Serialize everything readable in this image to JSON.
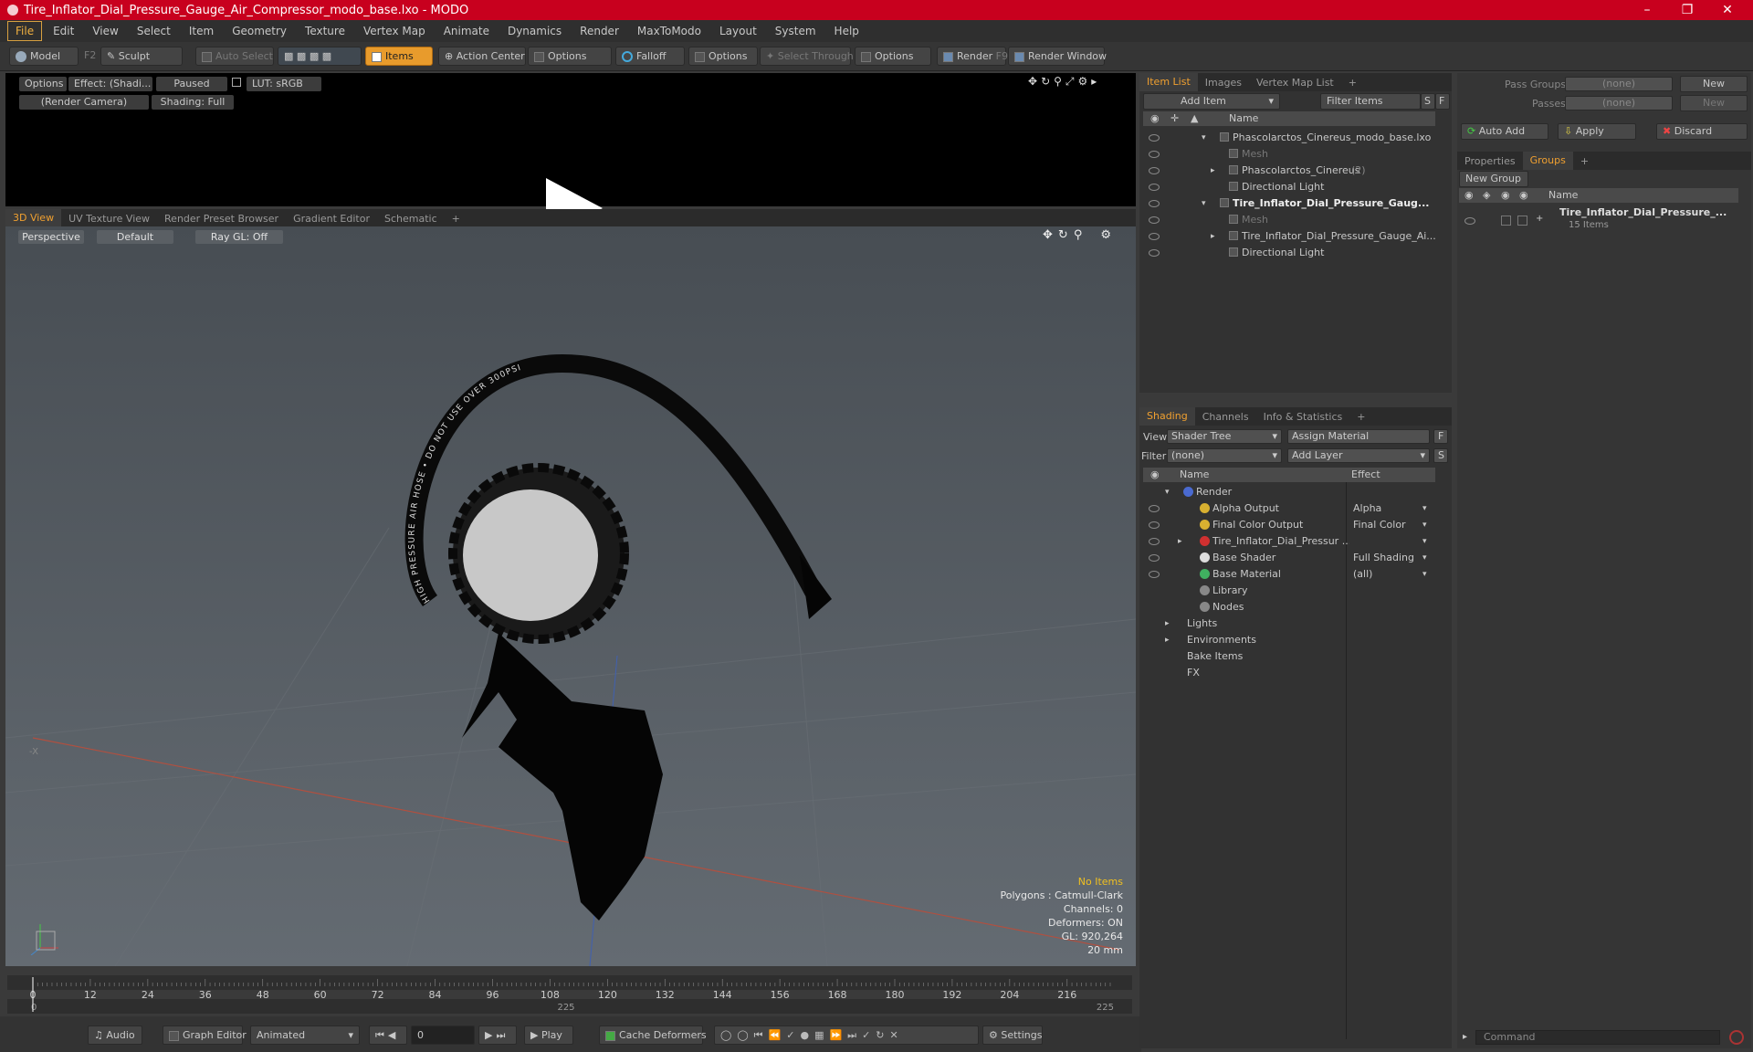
{
  "window": {
    "title": "Tire_Inflator_Dial_Pressure_Gauge_Air_Compressor_modo_base.lxo - MODO"
  },
  "menu": [
    "File",
    "Edit",
    "View",
    "Select",
    "Item",
    "Geometry",
    "Texture",
    "Vertex Map",
    "Animate",
    "Dynamics",
    "Render",
    "MaxToModo",
    "Layout",
    "System",
    "Help"
  ],
  "toolbar": {
    "model": "Model",
    "model_key": "F2",
    "sculpt": "Sculpt",
    "auto_select": "Auto Select",
    "items": "Items",
    "action_center": "Action Center",
    "options1": "Options",
    "falloff": "Falloff",
    "options2": "Options",
    "select_through": "Select Through",
    "options3": "Options",
    "render": "Render",
    "render_key": "F9",
    "render_window": "Render Window"
  },
  "render_strip": {
    "options": "Options",
    "effect": "Effect: (Shadi...",
    "paused": "Paused",
    "lut": "LUT: sRGB",
    "camera": "(Render Camera)",
    "shading": "Shading: Full"
  },
  "view_tabs": [
    "3D View",
    "UV Texture View",
    "Render Preset Browser",
    "Gradient Editor",
    "Schematic"
  ],
  "viewport": {
    "perspective": "Perspective",
    "default": "Default",
    "raygl": "Ray GL: Off",
    "hose_text": "HIGH PRESSURE AIR HOSE • DO NOT USE OVER 300PSI",
    "stats": {
      "items": "No Items",
      "polygons": "Polygons : Catmull-Clark",
      "channels": "Channels: 0",
      "deformers": "Deformers: ON",
      "gl": "GL: 920,264",
      "scale": "20 mm"
    }
  },
  "timeline": {
    "ticks": [
      "0",
      "12",
      "24",
      "36",
      "48",
      "60",
      "72",
      "84",
      "96",
      "108",
      "120",
      "132",
      "144",
      "156",
      "168",
      "180",
      "192",
      "204",
      "216"
    ],
    "start": "0",
    "mid": "225",
    "end": "225"
  },
  "bottom": {
    "audio": "Audio",
    "graph_editor": "Graph Editor",
    "animated": "Animated",
    "frame": "0",
    "play": "Play",
    "cache": "Cache Deformers",
    "settings": "Settings"
  },
  "item_list": {
    "tabs": [
      "Item List",
      "Images",
      "Vertex Map List"
    ],
    "add_item": "Add Item",
    "filter": "Filter Items",
    "s": "S",
    "f": "F",
    "col_name": "Name",
    "rows": [
      {
        "label": "Phascolarctos_Cinereus_modo_base.lxo",
        "indent": 0,
        "bold": false,
        "dim": false
      },
      {
        "label": "Mesh",
        "indent": 1,
        "bold": false,
        "dim": true
      },
      {
        "label": "Phascolarctos_Cinereus",
        "suffix": "(2)",
        "indent": 1,
        "bold": false,
        "dim": false
      },
      {
        "label": "Directional Light",
        "indent": 1,
        "bold": false,
        "dim": false
      },
      {
        "label": "Tire_Inflator_Dial_Pressure_Gaug...",
        "indent": 0,
        "bold": true,
        "dim": false
      },
      {
        "label": "Mesh",
        "indent": 1,
        "bold": false,
        "dim": true
      },
      {
        "label": "Tire_Inflator_Dial_Pressure_Gauge_Ai...",
        "indent": 1,
        "bold": false,
        "dim": false
      },
      {
        "label": "Directional Light",
        "indent": 1,
        "bold": false,
        "dim": false
      }
    ]
  },
  "shading": {
    "tabs": [
      "Shading",
      "Channels",
      "Info & Statistics"
    ],
    "view_label": "View",
    "view_value": "Shader Tree",
    "assign": "Assign Material",
    "f": "F",
    "filter_label": "Filter",
    "filter_value": "(none)",
    "add_layer": "Add Layer",
    "s": "S",
    "col_name": "Name",
    "col_effect": "Effect",
    "rows": [
      {
        "label": "Render",
        "effect": "",
        "indent": 0
      },
      {
        "label": "Alpha Output",
        "effect": "Alpha",
        "indent": 1
      },
      {
        "label": "Final Color Output",
        "effect": "Final Color",
        "indent": 1
      },
      {
        "label": "Tire_Inflator_Dial_Pressur ...",
        "effect": "",
        "indent": 1
      },
      {
        "label": "Base Shader",
        "effect": "Full Shading",
        "indent": 1
      },
      {
        "label": "Base Material",
        "effect": "(all)",
        "indent": 1
      },
      {
        "label": "Library",
        "effect": "",
        "indent": 1
      },
      {
        "label": "Nodes",
        "effect": "",
        "indent": 1
      },
      {
        "label": "Lights",
        "effect": "",
        "indent": 0
      },
      {
        "label": "Environments",
        "effect": "",
        "indent": 0
      },
      {
        "label": "Bake Items",
        "effect": "",
        "indent": 0
      },
      {
        "label": "FX",
        "effect": "",
        "indent": 0
      }
    ]
  },
  "groups": {
    "pass_groups": "Pass Groups",
    "pass_groups_value": "(none)",
    "new": "New",
    "passes": "Passes",
    "passes_value": "(none)",
    "new2": "New",
    "auto_add": "Auto Add",
    "apply": "Apply",
    "discard": "Discard",
    "tabs": [
      "Properties",
      "Groups"
    ],
    "new_group": "New Group",
    "col_name": "Name",
    "item_name": "Tire_Inflator_Dial_Pressure_...",
    "item_count": "15 Items"
  },
  "command": {
    "placeholder": "Command"
  }
}
